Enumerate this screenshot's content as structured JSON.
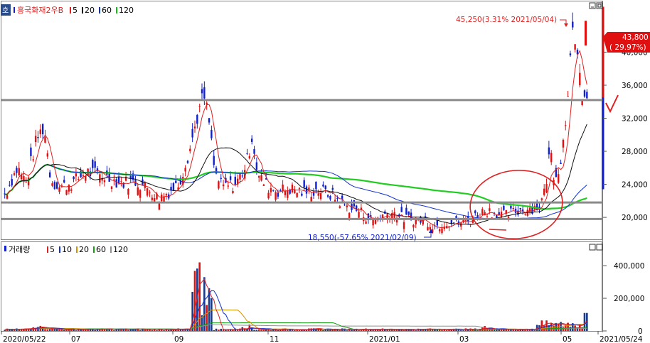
{
  "header": {
    "icon_label": "호",
    "stock_name": "흥국화재2우B",
    "ma_legend": [
      {
        "label": "5",
        "color": "#e02020"
      },
      {
        "label": "20",
        "color": "#000000"
      },
      {
        "label": "60",
        "color": "#1030d0"
      },
      {
        "label": "120",
        "color": "#10c010"
      }
    ]
  },
  "volume_header": {
    "title": "거래량",
    "ma_legend": [
      {
        "label": "5",
        "color": "#e02020"
      },
      {
        "label": "10",
        "color": "#1030d0"
      },
      {
        "label": "20",
        "color": "#d09000"
      },
      {
        "label": "60",
        "color": "#10a010"
      },
      {
        "label": "120",
        "color": "#909090"
      }
    ]
  },
  "colors": {
    "up": "#e01010",
    "down": "#1020d0",
    "ma120": "#22cc22",
    "annotation": "#e02020"
  },
  "icons": [
    "minimize-icon",
    "maximize-icon",
    "chevron-down-icon",
    "checkmark-icon"
  ],
  "chart_data": [
    {
      "type": "candlestick",
      "title": "흥국화재2우B",
      "y_ticks": [
        "40,000",
        "36,000",
        "32,000",
        "28,000",
        "24,000",
        "20,000"
      ],
      "y_tick_values": [
        40000,
        36000,
        32000,
        28000,
        24000,
        20000
      ],
      "ylim": [
        17600,
        45800
      ],
      "current_price_label": "43,800",
      "current_change_label": "( 29.97%)",
      "current_price": 43800,
      "high_annotation": "45,250(3.31% 2021/05/04)",
      "high_value": 45250,
      "low_annotation": "18,550(-57.65% 2021/02/09)",
      "low_value": 18550,
      "x_labels": [
        "2020/05/22",
        "07",
        "09",
        "11",
        "2021/01",
        "03",
        "05",
        "2021/05/24"
      ],
      "moving_averages": [
        5,
        20,
        60,
        120
      ],
      "horizontal_levels": [
        34200,
        21800,
        19800
      ],
      "grid": false
    },
    {
      "type": "bar",
      "title": "거래량",
      "y_ticks": [
        "400,000",
        "200,000",
        "0"
      ],
      "y_tick_values": [
        400000,
        200000,
        0
      ],
      "ylim": [
        0,
        470000
      ],
      "moving_averages": [
        5,
        10,
        20,
        60,
        120
      ]
    }
  ]
}
